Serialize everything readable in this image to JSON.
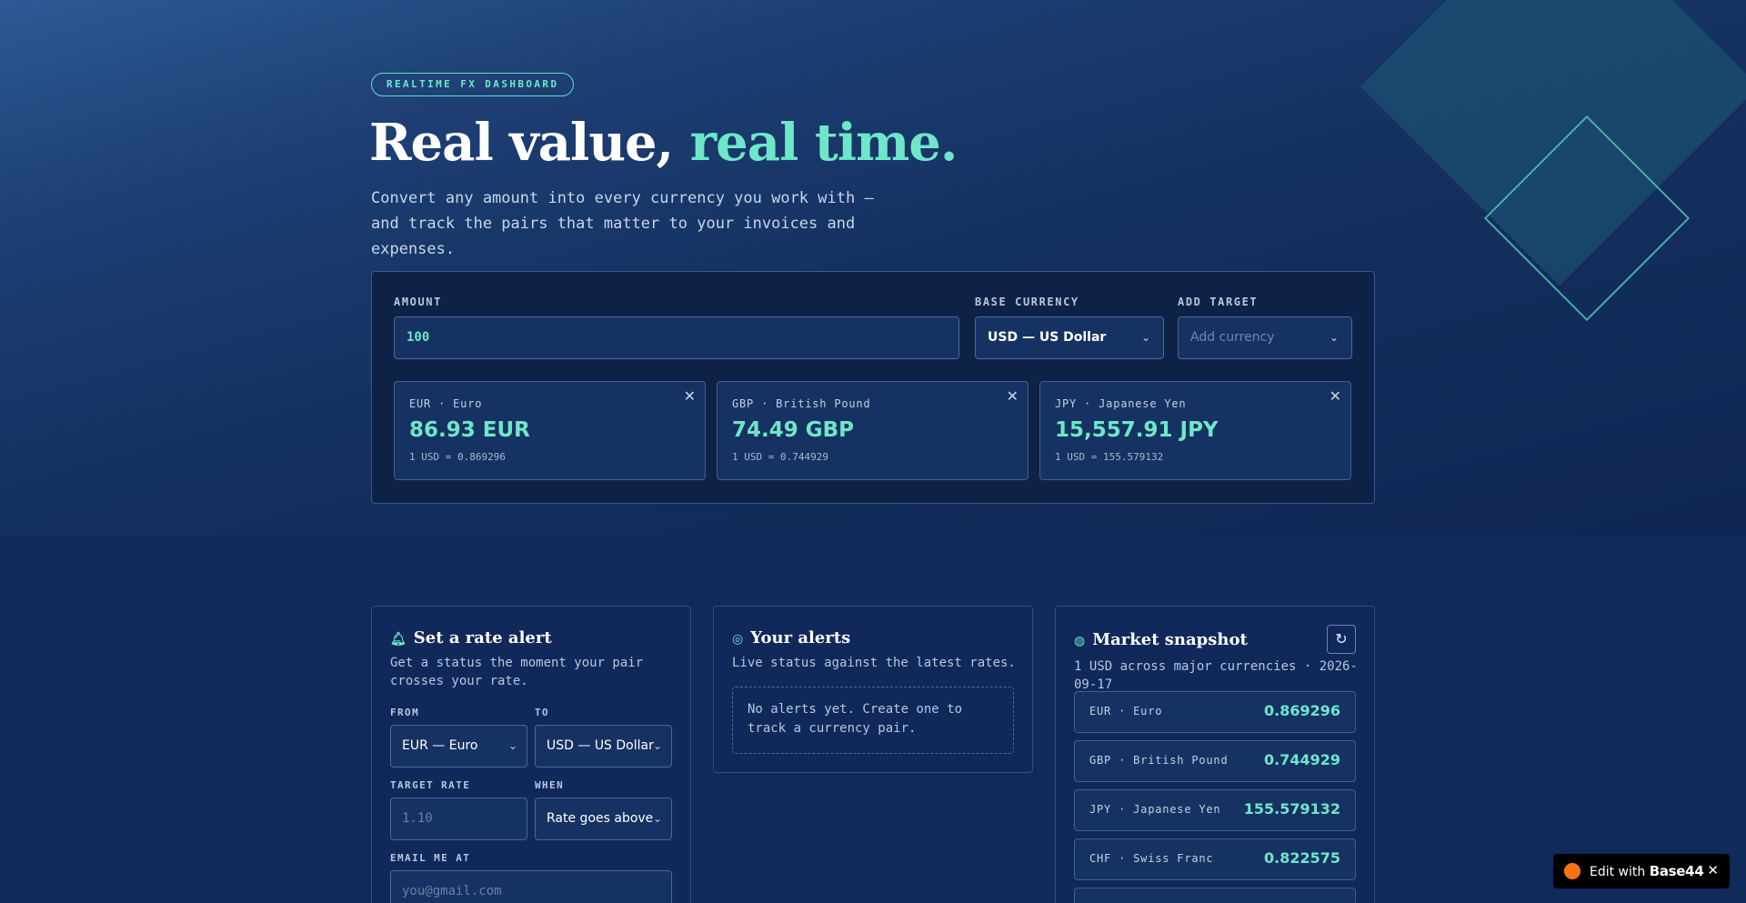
{
  "hero": {
    "badge": "REALTIME FX DASHBOARD",
    "headline_main": "Real value, ",
    "headline_accent": "real time.",
    "subline": "Convert any amount into every currency you work with — and track the pairs that matter to your invoices and expenses."
  },
  "converter": {
    "amount_label": "AMOUNT",
    "amount_value": "100",
    "base_label": "BASE CURRENCY",
    "base_value": "USD — US Dollar",
    "target_label": "ADD TARGET",
    "target_placeholder": "Add currency",
    "results": [
      {
        "label": "EUR · Euro",
        "value": "86.93 EUR",
        "rate": "1 USD = 0.869296"
      },
      {
        "label": "GBP · British Pound",
        "value": "74.49 GBP",
        "rate": "1 USD = 0.744929"
      },
      {
        "label": "JPY · Japanese Yen",
        "value": "15,557.91 JPY",
        "rate": "1 USD = 155.579132"
      }
    ]
  },
  "alert_form": {
    "title": "Set a rate alert",
    "desc": "Get a status the moment your pair crosses your rate.",
    "from_label": "FROM",
    "from_value": "EUR — Euro",
    "to_label": "TO",
    "to_value": "USD — US Dollar",
    "target_label": "TARGET RATE",
    "target_placeholder": "1.10",
    "when_label": "WHEN",
    "when_value": "Rate goes above",
    "email_label": "EMAIL ME AT",
    "email_placeholder": "you@gmail.com"
  },
  "alerts": {
    "title": "Your alerts",
    "desc": "Live status against the latest rates.",
    "empty": "No alerts yet. Create one to track a currency pair."
  },
  "snapshot": {
    "title": "Market snapshot",
    "desc": "1 USD across major currencies · 2026-09-17",
    "rows": [
      {
        "label": "EUR · Euro",
        "value": "0.869296"
      },
      {
        "label": "GBP · British Pound",
        "value": "0.744929"
      },
      {
        "label": "JPY · Japanese Yen",
        "value": "155.579132"
      },
      {
        "label": "CHF · Swiss Franc",
        "value": "0.822575"
      }
    ]
  },
  "edit_pill": {
    "prefix": "Edit with",
    "brand": "Base44"
  },
  "colors": {
    "accent": "#6ee7c9",
    "panel": "#10285a",
    "orange": "#f97316"
  },
  "icons": {
    "alert": "bell-icon",
    "alerts": "radar-icon",
    "snapshot": "globe-icon",
    "refresh": "refresh-icon",
    "close": "close-icon",
    "chevron": "chevron-down-icon"
  }
}
